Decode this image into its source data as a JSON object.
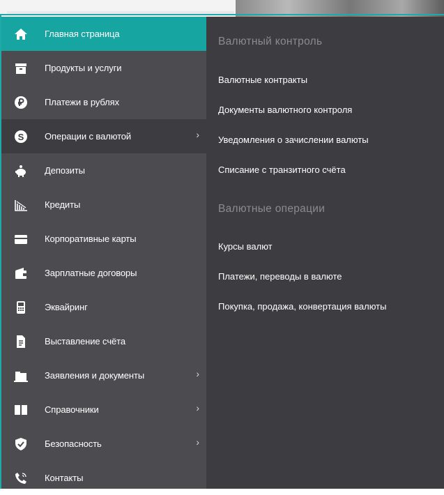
{
  "menu": {
    "items": [
      {
        "label": "Главная страница",
        "icon": "home-icon"
      },
      {
        "label": "Продукты и услуги",
        "icon": "box-icon"
      },
      {
        "label": "Платежи в рублях",
        "icon": "ruble-icon"
      },
      {
        "label": "Операции с валютой",
        "icon": "dollar-icon",
        "chevron": "›"
      },
      {
        "label": "Депозиты",
        "icon": "piggy-bank-icon"
      },
      {
        "label": "Кредиты",
        "icon": "chart-down-icon"
      },
      {
        "label": "Корпоративные карты",
        "icon": "card-icon"
      },
      {
        "label": "Зарплатные договоры",
        "icon": "wallet-icon"
      },
      {
        "label": "Эквайринг",
        "icon": "pos-terminal-icon"
      },
      {
        "label": "Выставление счёта",
        "icon": "document-icon"
      },
      {
        "label": "Заявления и документы",
        "icon": "folder-icon",
        "chevron": "›"
      },
      {
        "label": "Справочники",
        "icon": "book-icon",
        "chevron": "›"
      },
      {
        "label": "Безопасность",
        "icon": "shield-icon",
        "chevron": "›"
      },
      {
        "label": "Контакты",
        "icon": "phone-icon"
      }
    ]
  },
  "submenu": {
    "section1_title": "Валютный контроль",
    "section1_links": [
      "Валютные контракты",
      "Документы валютного контроля",
      "Уведомления о зачислении валюты",
      "Списание с транзитного счёта"
    ],
    "section2_title": "Валютные операции",
    "section2_links": [
      "Курсы валют",
      "Платежи, переводы в валюте",
      "Покупка, продажа, конвертация валюты"
    ]
  },
  "colors": {
    "accent": "#17a5a2",
    "menu_bg": "#4b4b50",
    "panel_bg": "#3c3c41",
    "section_title": "#8b8b90"
  }
}
